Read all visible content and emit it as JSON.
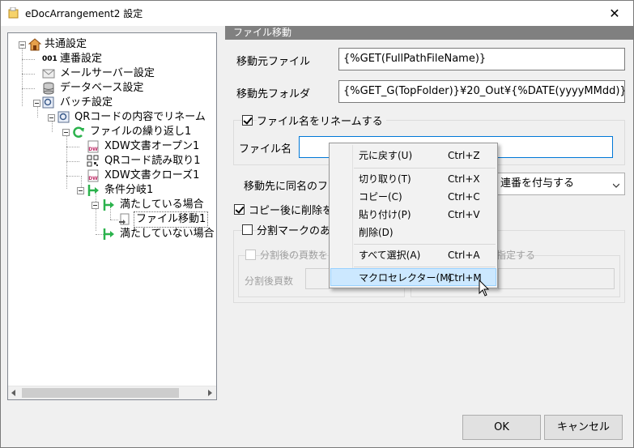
{
  "window": {
    "title": "eDocArrangement2 設定",
    "close_glyph": "✕"
  },
  "tree": {
    "items": [
      {
        "label": "共通設定",
        "icon": "house-icon"
      },
      {
        "label": "連番設定",
        "icon": "number-icon",
        "icon_text": "001"
      },
      {
        "label": "メールサーバー設定",
        "icon": "mail-icon"
      },
      {
        "label": "データベース設定",
        "icon": "database-icon"
      },
      {
        "label": "バッチ設定",
        "icon": "batch-icon"
      },
      {
        "label": "QRコードの内容でリネーム",
        "icon": "qr-rename-icon"
      },
      {
        "label": "ファイルの繰り返し1",
        "icon": "loop-icon"
      },
      {
        "label": "XDW文書オープン1",
        "icon": "xdw-icon",
        "icon_text": "DW"
      },
      {
        "label": "QRコード読み取り1",
        "icon": "qr-icon"
      },
      {
        "label": "XDW文書クローズ1",
        "icon": "xdw-icon",
        "icon_text": "DW"
      },
      {
        "label": "条件分岐1",
        "icon": "branch-icon"
      },
      {
        "label": "満たしている場合",
        "icon": "branch-icon"
      },
      {
        "label": "ファイル移動1",
        "icon": "file-move-icon"
      },
      {
        "label": "満たしていない場合",
        "icon": "branch-icon"
      }
    ]
  },
  "panel": {
    "section_title": "ファイル移動",
    "source_file_label": "移動元ファイル",
    "source_file_value": "{%GET(FullPathFileName)}",
    "dest_folder_label": "移動先フォルダ",
    "dest_folder_value": "{%GET_G(TopFolder)}¥20_Out¥{%DATE(yyyyMMdd)}",
    "rename_check_label": "ファイル名をリネームする",
    "filename_label": "ファイル名",
    "filename_value": "",
    "same_name_label": "移動先に同名のフ",
    "same_name_option": "連番を付与する",
    "delete_after_copy_label": "コピー後に削除を",
    "split_mark_label": "分割マークのあ",
    "split_pages_check_label": "分割後の頁数を",
    "split_pages_right_label": "指定する",
    "split_pages_label": "分割後頁数"
  },
  "buttons": {
    "ok": "OK",
    "cancel": "キャンセル"
  },
  "context_menu": {
    "items": [
      {
        "label": "元に戻す(U)",
        "shortcut": "Ctrl+Z"
      },
      {
        "label": "切り取り(T)",
        "shortcut": "Ctrl+X"
      },
      {
        "label": "コピー(C)",
        "shortcut": "Ctrl+C"
      },
      {
        "label": "貼り付け(P)",
        "shortcut": "Ctrl+V"
      },
      {
        "label": "削除(D)",
        "shortcut": ""
      },
      {
        "label": "すべて選択(A)",
        "shortcut": "Ctrl+A"
      },
      {
        "label": "マクロセレクター(M)",
        "shortcut": "Ctrl+M"
      }
    ]
  },
  "colors": {
    "accent": "#0078d7",
    "menu_highlight": "#cce8ff",
    "section_header": "#808080",
    "branch_green": "#2bb24c"
  }
}
